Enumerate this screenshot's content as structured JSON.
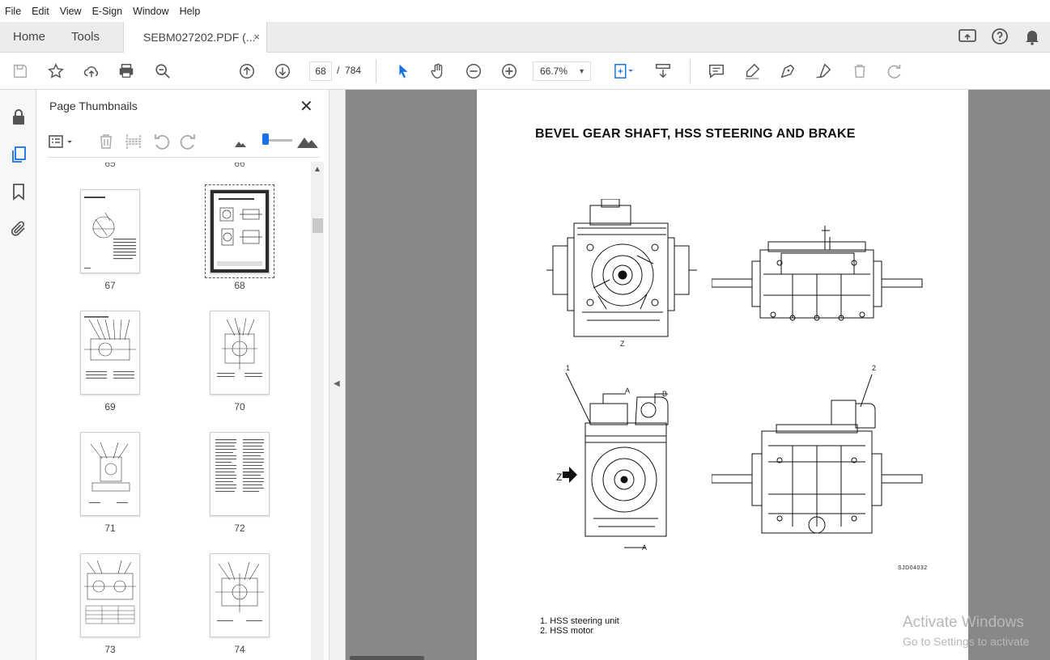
{
  "menubar": {
    "items": [
      "File",
      "Edit",
      "View",
      "E-Sign",
      "Window",
      "Help"
    ]
  },
  "tabs": {
    "home": "Home",
    "tools": "Tools",
    "document": "SEBM027202.PDF (...",
    "close_glyph": "×"
  },
  "toolbar": {
    "current_page": "68",
    "page_separator": "/",
    "total_pages": "784",
    "zoom": "66.7%"
  },
  "thumbnail_panel": {
    "title": "Page Thumbnails",
    "close_glyph": "✕",
    "pages": [
      {
        "number": "67"
      },
      {
        "number": "68",
        "selected": true
      },
      {
        "number": "69"
      },
      {
        "number": "70"
      },
      {
        "number": "71"
      },
      {
        "number": "72"
      },
      {
        "number": "73"
      },
      {
        "number": "74"
      }
    ],
    "cut_off_above": [
      "65",
      "66"
    ]
  },
  "document_page": {
    "title": "BEVEL GEAR SHAFT, HSS STEERING AND BRAKE",
    "figure_code": "SJD04032",
    "view_label_z": "Z",
    "callout_1": "1",
    "callout_2": "2",
    "section_a": "A",
    "section_b": "B",
    "legend": [
      "1. HSS steering unit",
      "2. HSS motor"
    ]
  },
  "watermark": {
    "line1": "Activate Windows",
    "line2": "Go to Settings to activate"
  },
  "colors": {
    "accent": "#1473e6",
    "viewer_bg": "#888888",
    "tab_bar": "#ececec"
  }
}
